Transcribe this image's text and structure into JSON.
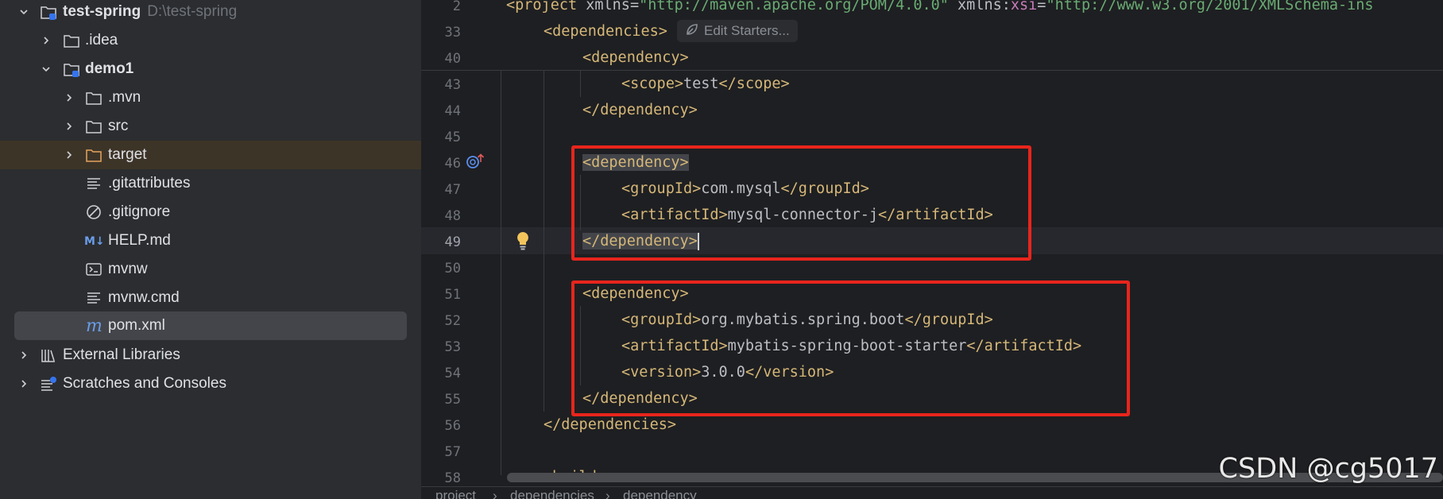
{
  "tree": {
    "root": {
      "name": "test-spring",
      "path": "D:\\test-spring"
    },
    "items": [
      {
        "label": ".idea"
      },
      {
        "label": "demo1"
      },
      {
        "label": ".mvn"
      },
      {
        "label": "src"
      },
      {
        "label": "target"
      },
      {
        "label": ".gitattributes"
      },
      {
        "label": ".gitignore"
      },
      {
        "label": "HELP.md"
      },
      {
        "label": "mvnw"
      },
      {
        "label": "mvnw.cmd"
      },
      {
        "label": "pom.xml"
      },
      {
        "label": "External Libraries"
      },
      {
        "label": "Scratches and Consoles"
      }
    ]
  },
  "editor": {
    "edit_starters": "Edit Starters...",
    "line_numbers": [
      "2",
      "33",
      "40",
      "43",
      "44",
      "45",
      "46",
      "47",
      "48",
      "49",
      "50",
      "51",
      "52",
      "53",
      "54",
      "55",
      "56",
      "57",
      "58"
    ],
    "code": {
      "project_url": "\"http://maven.apache.org/POM/4.0.0\"",
      "xsi_url": "\"http://www.w3.org/2001/XMLSchema-ins",
      "scope_value": "test",
      "mysql_group": "com.mysql",
      "mysql_artifact": "mysql-connector-j",
      "mybatis_group": "org.mybatis.spring.boot",
      "mybatis_artifact": "mybatis-spring-boot-starter",
      "mybatis_version": "3.0.0"
    },
    "breadcrumb": [
      "project",
      "dependencies",
      "dependency"
    ]
  },
  "watermark": "CSDN @cg5017"
}
